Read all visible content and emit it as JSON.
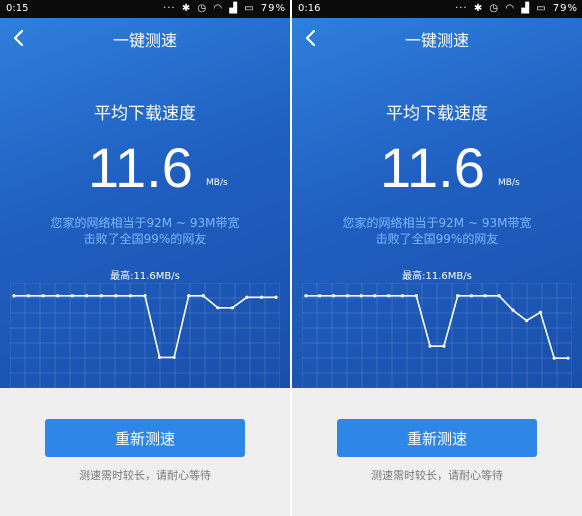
{
  "screens": [
    {
      "status": {
        "time": "0:15",
        "battery": "79%"
      },
      "title": "一键测速",
      "speed_label": "平均下载速度",
      "speed_value": "11.6",
      "speed_unit": "MB/s",
      "compare_line1": "您家的网络相当于92M ~ 93M带宽",
      "compare_line2": "击败了全国99%的网友",
      "max_label": "最高:11.6MB/s",
      "retest_label": "重新测速",
      "hint": "测速需时较长，请耐心等待",
      "chart_data": {
        "type": "line",
        "values": [
          11.6,
          11.6,
          11.6,
          11.6,
          11.6,
          11.6,
          11.6,
          11.6,
          11.6,
          11.6,
          3.4,
          3.4,
          11.6,
          11.6,
          10.0,
          10.0,
          11.4,
          11.4,
          11.4
        ],
        "ylim": [
          0,
          12.5
        ],
        "grid": true
      }
    },
    {
      "status": {
        "time": "0:16",
        "battery": "79%"
      },
      "title": "一键测速",
      "speed_label": "平均下载速度",
      "speed_value": "11.6",
      "speed_unit": "MB/s",
      "compare_line1": "您家的网络相当于92M ~ 93M带宽",
      "compare_line2": "击败了全国99%的网友",
      "max_label": "最高:11.6MB/s",
      "retest_label": "重新测速",
      "hint": "测速需时较长，请耐心等待",
      "chart_data": {
        "type": "line",
        "values": [
          11.6,
          11.6,
          11.6,
          11.6,
          11.6,
          11.6,
          11.6,
          11.6,
          11.6,
          4.9,
          4.9,
          11.6,
          11.6,
          11.6,
          11.6,
          9.7,
          8.3,
          9.4,
          3.3,
          3.3
        ],
        "ylim": [
          0,
          12.5
        ],
        "grid": true
      }
    }
  ],
  "colors": {
    "accent": "#2e86e6",
    "compare_text": "#7fb7ff",
    "screen_top": "#2f7fdc",
    "screen_bottom": "#1a4fac"
  }
}
